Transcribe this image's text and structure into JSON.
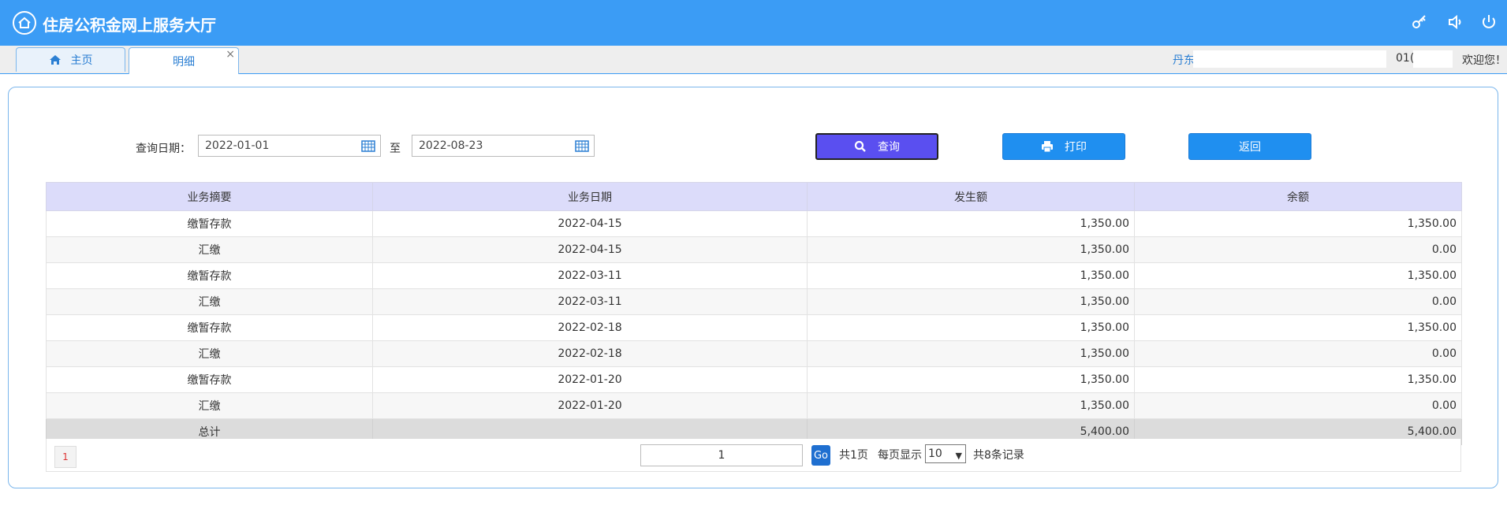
{
  "header": {
    "title": "住房公积金网上服务大厅",
    "icons": [
      "home-logo-icon",
      "key-icon",
      "speaker-icon",
      "power-icon"
    ]
  },
  "tabs": [
    {
      "label": "主页",
      "icon": "home-icon"
    },
    {
      "label": "明细",
      "close": "×"
    }
  ],
  "user": {
    "name_prefix": "丹东",
    "account_prefix": "01(",
    "welcome": "欢迎您！"
  },
  "query": {
    "date_label": "查询日期：",
    "start_date": "2022-01-01",
    "to_label": "至",
    "end_date": "2022-08-23",
    "buttons": {
      "search": "查询",
      "print": "打印",
      "back": "返回"
    }
  },
  "table": {
    "columns": [
      "业务摘要",
      "业务日期",
      "发生额",
      "余额"
    ],
    "rows": [
      {
        "summary": "缴暂存款",
        "date": "2022-04-15",
        "amount": "1,350.00",
        "balance": "1,350.00"
      },
      {
        "summary": "汇缴",
        "date": "2022-04-15",
        "amount": "1,350.00",
        "balance": "0.00"
      },
      {
        "summary": "缴暂存款",
        "date": "2022-03-11",
        "amount": "1,350.00",
        "balance": "1,350.00"
      },
      {
        "summary": "汇缴",
        "date": "2022-03-11",
        "amount": "1,350.00",
        "balance": "0.00"
      },
      {
        "summary": "缴暂存款",
        "date": "2022-02-18",
        "amount": "1,350.00",
        "balance": "1,350.00"
      },
      {
        "summary": "汇缴",
        "date": "2022-02-18",
        "amount": "1,350.00",
        "balance": "0.00"
      },
      {
        "summary": "缴暂存款",
        "date": "2022-01-20",
        "amount": "1,350.00",
        "balance": "1,350.00"
      },
      {
        "summary": "汇缴",
        "date": "2022-01-20",
        "amount": "1,350.00",
        "balance": "0.00"
      }
    ],
    "total": {
      "label": "总计",
      "amount": "5,400.00",
      "balance": "5,400.00"
    }
  },
  "pager": {
    "current_page_button": "1",
    "page_input": "1",
    "go": "Go",
    "total_pages": "共1页",
    "per_page_label": "每页显示",
    "per_page_value": "10",
    "total_records": "共8条记录"
  },
  "colors": {
    "header_bg": "#3b9cf5",
    "search_button": "#5a4ff0",
    "button": "#1f8ff0",
    "table_header": "#dcdcfa"
  }
}
